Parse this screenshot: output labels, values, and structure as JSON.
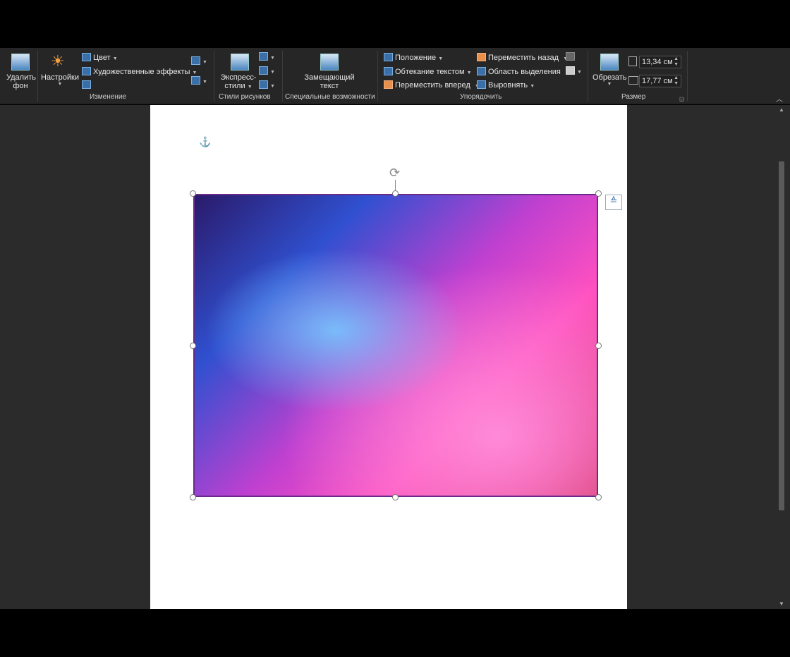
{
  "ribbon": {
    "remove_bg": [
      "Удалить",
      "фон"
    ],
    "settings": "Настройки",
    "color": "Цвет",
    "art_effects": "Художественные эффекты",
    "group_change": "Изменение",
    "express": [
      "Экспресс-",
      "стили"
    ],
    "group_styles": "Стили рисунков",
    "alt_text": [
      "Замещающий",
      "текст"
    ],
    "group_access": "Специальные возможности",
    "position": "Положение",
    "wrap": "Обтекание текстом",
    "forward": "Переместить вперед",
    "backward": "Переместить назад",
    "selection_pane": "Область выделения",
    "align": "Выровнять",
    "group_arrange": "Упорядочить",
    "crop": "Обрезать",
    "height": "13,34 см",
    "width": "17,77 см",
    "group_size": "Размер"
  }
}
